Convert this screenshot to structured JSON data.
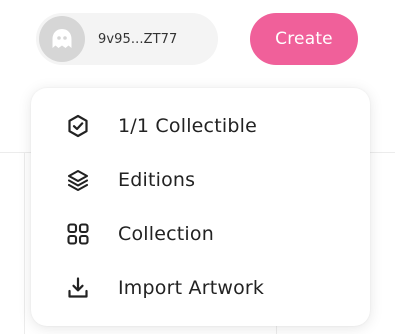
{
  "header": {
    "wallet": {
      "address": "9v95...ZT77",
      "avatar_icon": "ghost-avatar-icon"
    },
    "create_label": "Create"
  },
  "create_menu": {
    "items": [
      {
        "label": "1/1 Collectible",
        "icon": "shield-check-icon"
      },
      {
        "label": "Editions",
        "icon": "layers-icon"
      },
      {
        "label": "Collection",
        "icon": "grid-icon"
      },
      {
        "label": "Import Artwork",
        "icon": "download-icon"
      }
    ]
  },
  "colors": {
    "accent": "#f0609a",
    "pill_background": "#f4f4f4",
    "text": "#222222"
  }
}
